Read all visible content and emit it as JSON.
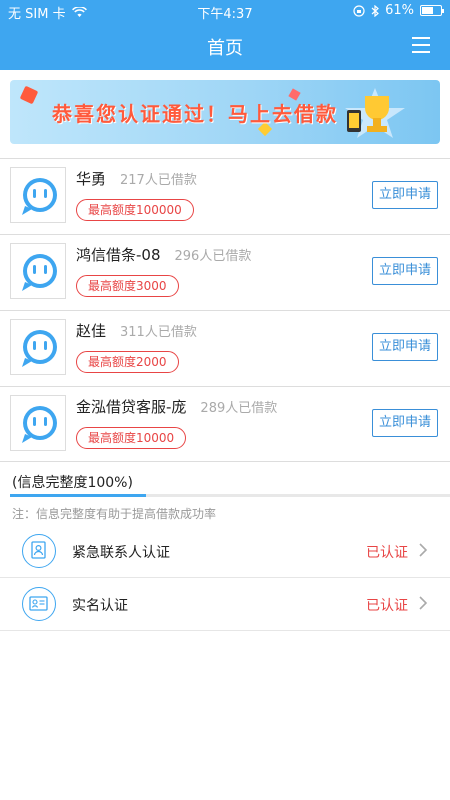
{
  "status_bar": {
    "carrier": "无 SIM 卡",
    "time": "下午4:37",
    "battery": "61%",
    "battery_level": 0.61
  },
  "nav": {
    "title": "首页"
  },
  "banner": {
    "text": "恭喜您认证通过！马上去借款"
  },
  "loans": [
    {
      "name": "华勇",
      "count": "217人已借款",
      "limit": "最高额度100000",
      "apply": "立即申请"
    },
    {
      "name": "鸿信借条-08",
      "count": "296人已借款",
      "limit": "最高额度3000",
      "apply": "立即申请"
    },
    {
      "name": "赵佳",
      "count": "311人已借款",
      "limit": "最高额度2000",
      "apply": "立即申请"
    },
    {
      "name": "金泓借贷客服-庞",
      "count": "289人已借款",
      "limit": "最高额度10000",
      "apply": "立即申请"
    }
  ],
  "completeness": {
    "label": "(信息完整度100%)",
    "progress": 0.31
  },
  "note": "注：信息完整度有助于提高借款成功率",
  "certifications": [
    {
      "label": "紧急联系人认证",
      "status": "已认证",
      "icon": "contact-card-icon"
    },
    {
      "label": "实名认证",
      "status": "已认证",
      "icon": "id-card-icon"
    }
  ],
  "colors": {
    "primary": "#3ea6f0",
    "accent": "#e84545",
    "button": "#3a8fd8"
  }
}
